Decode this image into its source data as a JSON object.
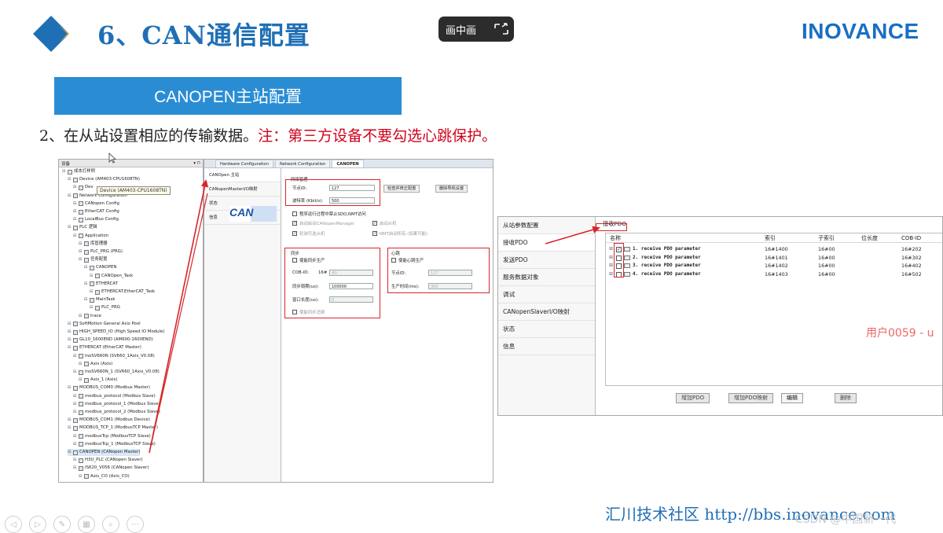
{
  "header": {
    "title": "6、CAN通信配置",
    "brand": "INOVANCE",
    "pip_label": "画中画"
  },
  "banner": {
    "label": "CANOPEN主站配置"
  },
  "step": {
    "text": "2、在从站设置相应的传输数据。",
    "note": "注：第三方设备不要勾选心跳保护。"
  },
  "tree": {
    "header": "设备",
    "tooltip": "Device (AM403-CPU1608TN)",
    "rows": [
      "成本打样例",
      "Device (AM403-CPU1608TN)",
      "Dev",
      "Network Configuration",
      "CANopen Config",
      "EtherCAT Config",
      "LocalBus Config",
      "PLC 逻辑",
      "Application",
      "库管理器",
      "PLC_PRG (PRG)",
      "任务配置",
      "CANOPEN",
      "CANOpen_Task",
      "ETHERCAT",
      "ETHERCAT.EtherCAT_Task",
      "MainTask",
      "PLC_PRG",
      "trace",
      "SoftMotion General Axis Pool",
      "HIGH_SPEED_IO (High Speed IO Module)",
      "GL10_1600END (AM600-1600END)",
      "ETHERCAT (EtherCAT Master)",
      "InoSV660N (SV660_1Axis_V0.08)",
      "Axis (Axis)",
      "InoSV660N_1 (SV660_1Axis_V0.08)",
      "Axis_1 (Axis)",
      "MODBUS_COM0 (Modbus Master)",
      "modbus_protocol (Modbus Slave)",
      "modbus_protocol_1 (Modbus Slave)",
      "modbus_protocol_2 (Modbus Slave)",
      "MODBUS_COM1 (Modbus Device)",
      "MODBUS_TCP_1 (ModbusTCP Master)",
      "modbusTcp (ModbusTCP Slave)",
      "modbusTcp_1 (ModbusTCP Slave)",
      "CANOPEN (CANopen Master)",
      "H3U_PLC (CANopen Slaver)",
      "IS620_V056 (CANopen Slaver)",
      "Axis_CO (Axis_CO)"
    ]
  },
  "mid": {
    "tabs": [
      "Hardware Configuration",
      "Network Configuration",
      "CANOPEN"
    ],
    "side": [
      "CANOpen 主站",
      "CANopenMasterI/O映射",
      "状态",
      "信息"
    ],
    "group_net": "网络管理",
    "node_id_label": "节点ID:",
    "node_id_value": "127",
    "baud_label": "波特率 (Kbit/s):",
    "baud_value": "500",
    "btn_check": "检查并修正配置",
    "btn_delete": "删除导机设置",
    "chk_sdo": "程序运行过程中禁止SDO,NMT访问",
    "chk_auto": "自动启动CANopenManager",
    "chk_start_slave": "启动从机",
    "chk_poll": "轮询可选从机",
    "chk_nmt": "NMT启动所有 (如果可能)",
    "can_logo": "CAN",
    "group_sync": "同步",
    "sync_enable": "使能同步生产",
    "cob_label": "COB-ID:",
    "cob_prefix": "16#",
    "cob_value": "80",
    "period_label": "同步周期(us):",
    "period_value": "100000",
    "window_label": "窗口长度(us):",
    "window_value": "0",
    "sync_consume": "使能同步消费",
    "group_hb": "心跳",
    "hb_enable": "使能心跳生产",
    "hb_node_label": "节点ID:",
    "hb_node_value": "127",
    "hb_time_label": "生产时间(ms):",
    "hb_time_value": "300"
  },
  "right": {
    "side": [
      "从站参数配置",
      "接收PDO",
      "发送PDO",
      "服务数据对象",
      "调试",
      "CANopenSlaverI/O映射",
      "状态",
      "信息"
    ],
    "header": "接收PDO",
    "cols": [
      "名称",
      "索引",
      "子索引",
      "位长度",
      "COB-ID"
    ],
    "rows": [
      {
        "name": "1. receive PDO parameter",
        "index": "16#1400",
        "sub": "16#00",
        "cob": "16#202"
      },
      {
        "name": "2. receive PDO parameter",
        "index": "16#1401",
        "sub": "16#00",
        "cob": "16#302"
      },
      {
        "name": "3. receive PDO parameter",
        "index": "16#1402",
        "sub": "16#00",
        "cob": "16#402"
      },
      {
        "name": "4. receive PDO parameter",
        "index": "16#1403",
        "sub": "16#00",
        "cob": "16#502"
      }
    ],
    "buttons": [
      "增加PDO",
      "增加PDO映射",
      "编辑",
      "删除"
    ],
    "watermark": "用户0059 - u"
  },
  "footer": {
    "text": "汇川技术社区 http://bbs.inovance.com",
    "csdn": "CSDN @中国新一代"
  },
  "colors": {
    "title_blue": "#1f6fb5",
    "banner_blue": "#2a8dd4",
    "note_red": "#d0021b",
    "highlight_red": "#d7262b"
  }
}
